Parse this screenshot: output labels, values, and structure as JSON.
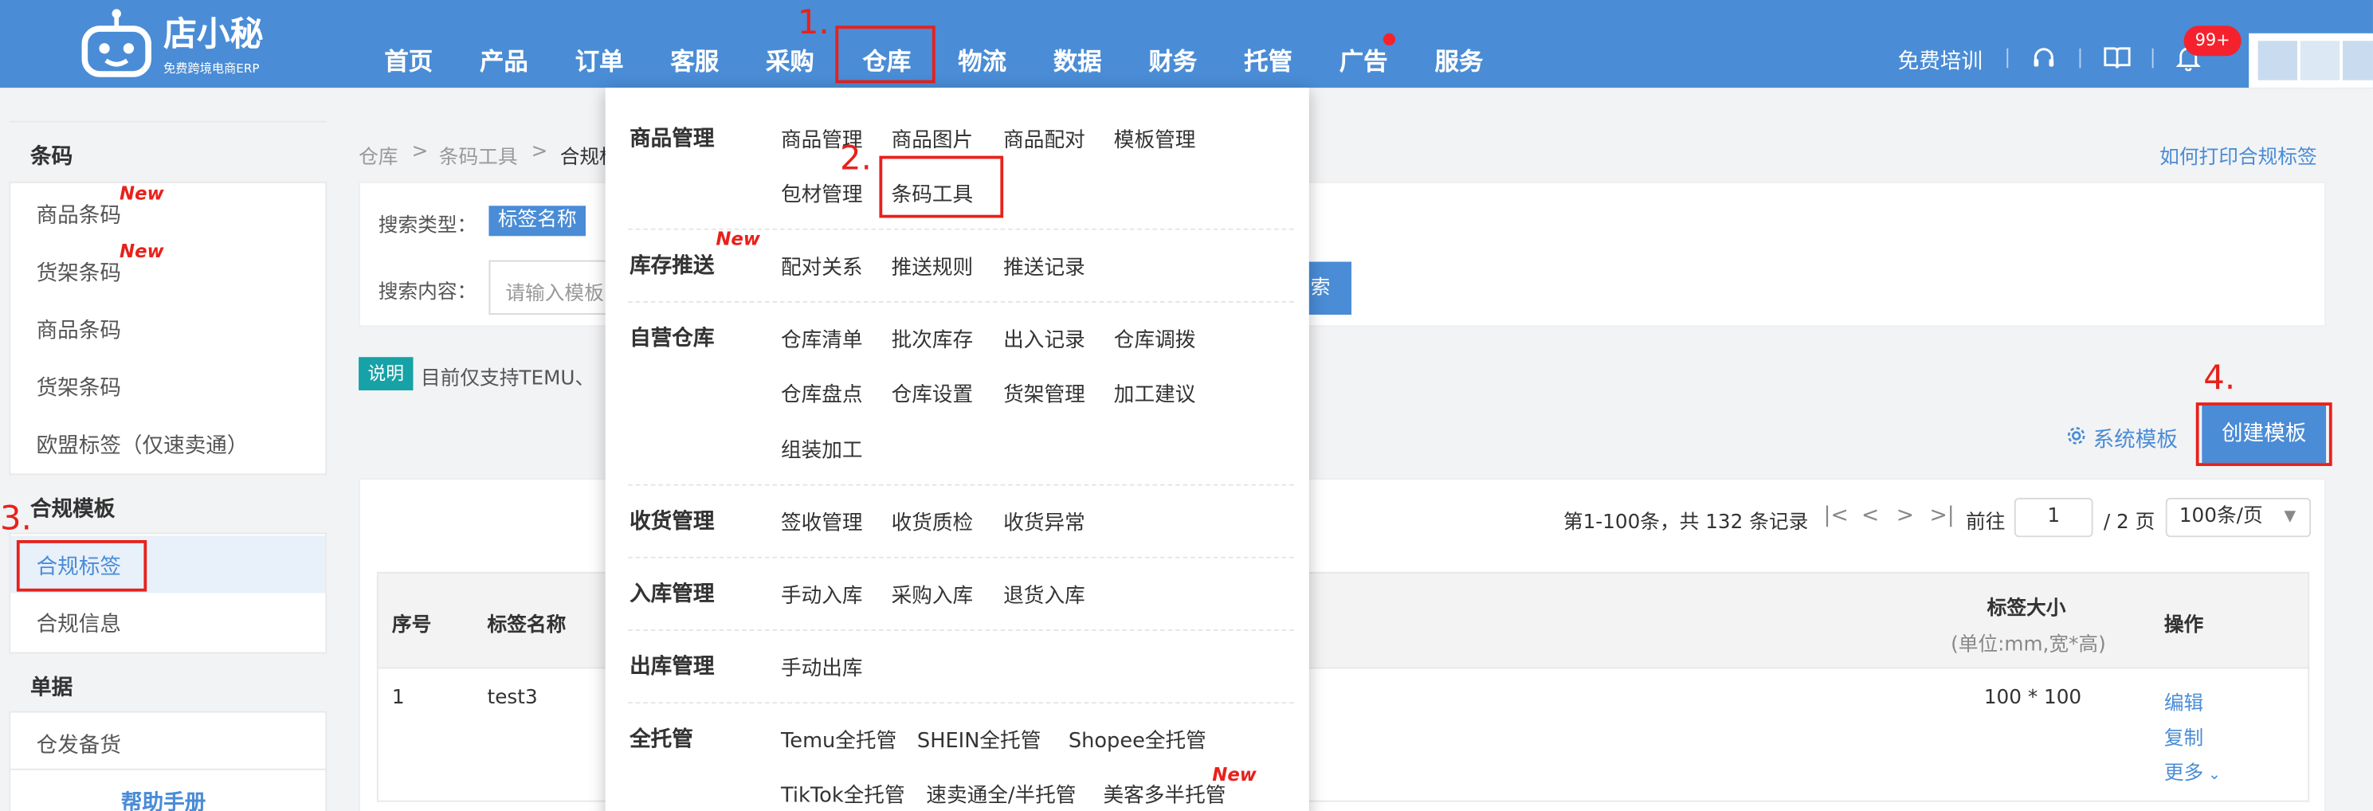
{
  "colors": {
    "nav": "#4a8cd6",
    "accent_red": "#e8211b",
    "note_teal": "#16a2a6"
  },
  "logo": {
    "title": "店小秘",
    "subtitle": "免费跨境电商ERP",
    "icon": "robot-logo-icon"
  },
  "nav": {
    "items": [
      "首页",
      "产品",
      "订单",
      "客服",
      "采购",
      "仓库",
      "物流",
      "数据",
      "财务",
      "托管",
      "广告",
      "服务"
    ],
    "training": "免费培训",
    "badge": "99+",
    "icons": [
      "headset-icon",
      "book-icon",
      "bell-icon"
    ]
  },
  "steps": [
    "1.",
    "2.",
    "3.",
    "4."
  ],
  "sidebar": {
    "groups": [
      {
        "title": "条码",
        "items": [
          "商品条码",
          "货架条码",
          "商品条码",
          "货架条码",
          "欧盟标签（仅速卖通）"
        ]
      },
      {
        "title": "合规模板",
        "items": [
          "合规标签",
          "合规信息"
        ]
      },
      {
        "title": "单据",
        "items": [
          "仓发备货"
        ]
      }
    ],
    "new_tag": "New",
    "help": "帮助手册"
  },
  "breadcrumb": [
    "仓库",
    ">",
    "条码工具",
    ">",
    "合规标"
  ],
  "help_link": "如何打印合规标签",
  "search": {
    "type_label": "搜索类型：",
    "type_value": "标签名称",
    "content_label": "搜索内容：",
    "placeholder": "请输入模板",
    "button": "索"
  },
  "note": {
    "tag": "说明",
    "text": "目前仅支持TEMU、"
  },
  "actions": {
    "system_template": "系统模板",
    "create": "创建模板"
  },
  "pagination": {
    "summary": "第1-100条，共 132 条记录",
    "goto": "前往",
    "page": "1",
    "total": "/ 2 页",
    "per_page": "100条/页"
  },
  "table": {
    "headers": {
      "index": "序号",
      "name": "标签名称",
      "size": "标签大小",
      "size_unit": "(单位:mm,宽*高)",
      "ops": "操作"
    },
    "rows": [
      {
        "index": "1",
        "name": "test3",
        "size": "100 * 100",
        "ops": [
          "编辑",
          "复制",
          "更多"
        ]
      }
    ]
  },
  "dropdown": {
    "sections": [
      {
        "title": "商品管理",
        "rows": [
          [
            "商品管理",
            "商品图片",
            "商品配对",
            "模板管理"
          ],
          [
            "包材管理",
            "条码工具"
          ]
        ]
      },
      {
        "title": "库存推送",
        "rows": [
          [
            "配对关系",
            "推送规则",
            "推送记录"
          ]
        ]
      },
      {
        "title": "自营仓库",
        "rows": [
          [
            "仓库清单",
            "批次库存",
            "出入记录",
            "仓库调拨"
          ],
          [
            "仓库盘点",
            "仓库设置",
            "货架管理",
            "加工建议"
          ],
          [
            "组装加工"
          ]
        ]
      },
      {
        "title": "收货管理",
        "rows": [
          [
            "签收管理",
            "收货质检",
            "收货异常"
          ]
        ]
      },
      {
        "title": "入库管理",
        "rows": [
          [
            "手动入库",
            "采购入库",
            "退货入库"
          ]
        ]
      },
      {
        "title": "出库管理",
        "rows": [
          [
            "手动出库"
          ]
        ]
      },
      {
        "title": "全托管",
        "rows": [
          [
            "Temu全托管",
            "SHEIN全托管",
            "Shopee全托管"
          ],
          [
            "TikTok全托管",
            "速卖通全/半托管",
            "美客多半托管"
          ]
        ]
      }
    ]
  }
}
